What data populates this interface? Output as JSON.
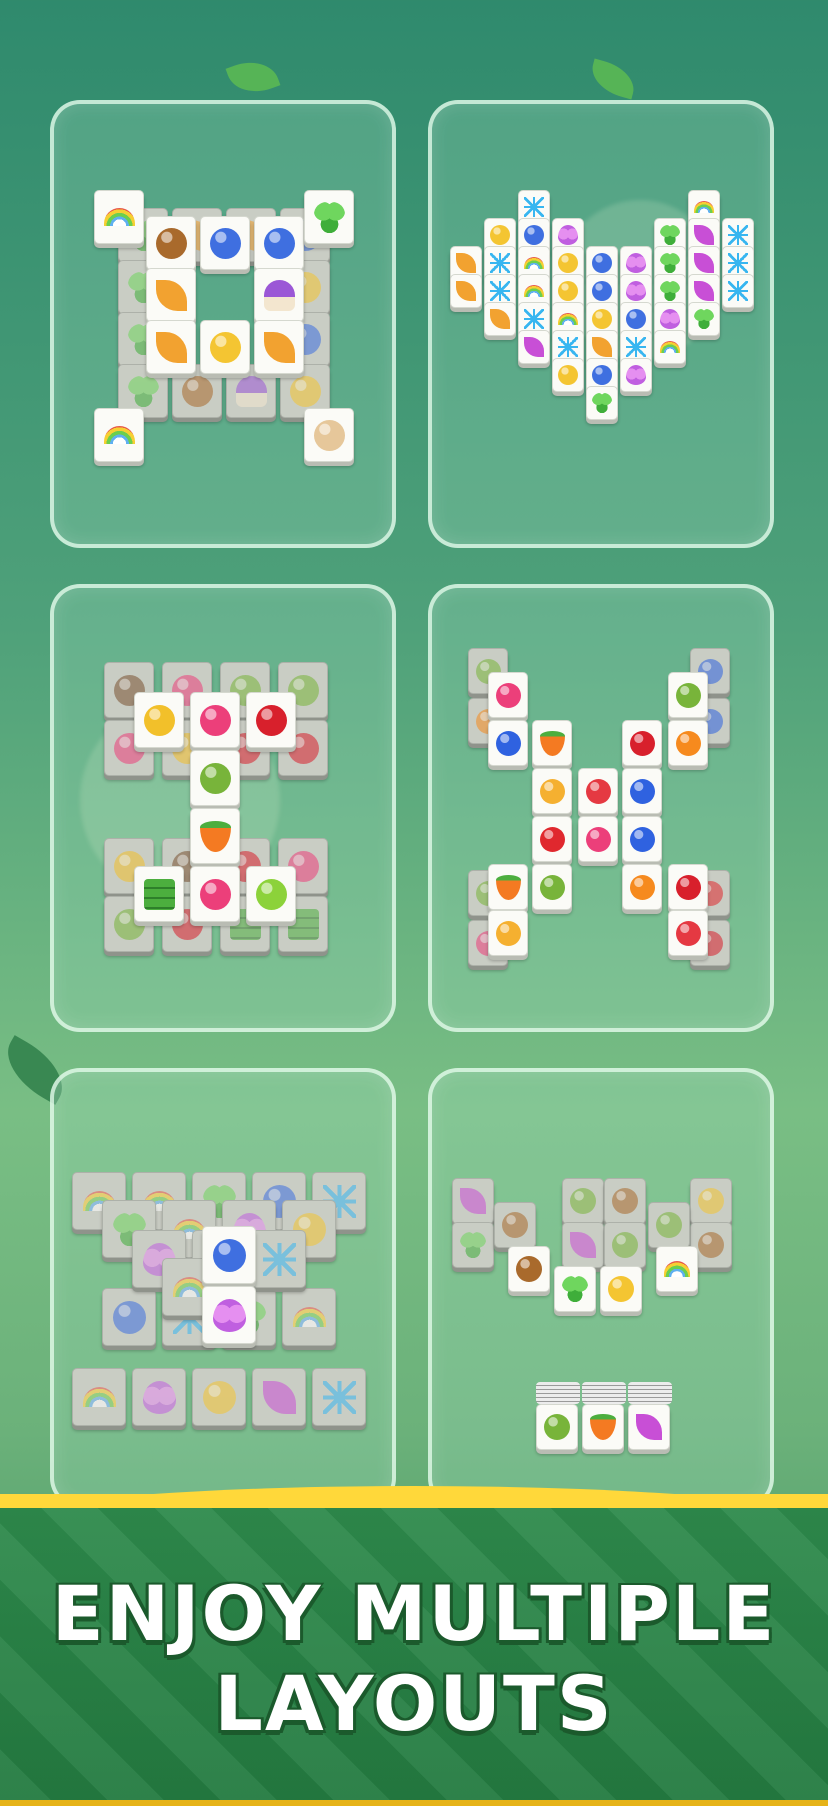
{
  "headline": {
    "line1": "ENJOY MULTIPLE",
    "line2": "LAYOUTS"
  },
  "colors": {
    "accent": "#ffd83a",
    "banner": "#2e8a4c",
    "title": "#ffffff",
    "title_outline": "#1b5a2c"
  },
  "icon_colors": {
    "rainbow": "#e8594a",
    "clover": "#3fae3a",
    "leaf": "#f2a230",
    "acorn": "#a96a2c",
    "flower": "#3f6fe0",
    "mushroom": "#9b57d6",
    "tulip": "#f4c532",
    "shell": "#e6c79a",
    "snow": "#38b6f0",
    "butterfly": "#c05fe0",
    "feather": "#c84fd6",
    "coconut": "#7a5232",
    "corn": "#f2c02a",
    "dragonfruit": "#ec3f7a",
    "cherry": "#d8202c",
    "avocado": "#78b43a",
    "carrot": "#f47a22",
    "bamboo": "#4cae3e",
    "pepper": "#8cd23a",
    "orange": "#f68a1e",
    "blueberry": "#2f62e0",
    "apple": "#e0282e",
    "peach": "#f5b030",
    "strawberry": "#e53942"
  },
  "layouts": [
    {
      "name": "square-ring",
      "tiles": [
        "rainbow",
        "clover",
        "acorn",
        "flower",
        "flower",
        "leaf",
        "mushroom",
        "leaf",
        "tulip",
        "leaf",
        "rainbow",
        "shell"
      ]
    },
    {
      "name": "heart",
      "tiles": [
        "snow",
        "rainbow",
        "tulip",
        "flower",
        "butterfly",
        "clover",
        "feather",
        "snow",
        "leaf"
      ]
    },
    {
      "name": "i-beam",
      "tiles": [
        "corn",
        "dragonfruit",
        "cherry",
        "avocado",
        "carrot",
        "bamboo",
        "dragonfruit",
        "pepper"
      ]
    },
    {
      "name": "x-cross",
      "tiles": [
        "dragonfruit",
        "blueberry",
        "carrot",
        "avocado",
        "orange",
        "cherry",
        "peach",
        "strawberry",
        "blueberry",
        "apple"
      ]
    },
    {
      "name": "stacked-pyramid",
      "tiles": [
        "rainbow",
        "clover",
        "flower",
        "butterfly",
        "snow",
        "feather"
      ]
    },
    {
      "name": "w-shape",
      "tiles": [
        "acorn",
        "clover",
        "tulip",
        "rainbow",
        "avocado",
        "carrot",
        "feather"
      ]
    }
  ]
}
